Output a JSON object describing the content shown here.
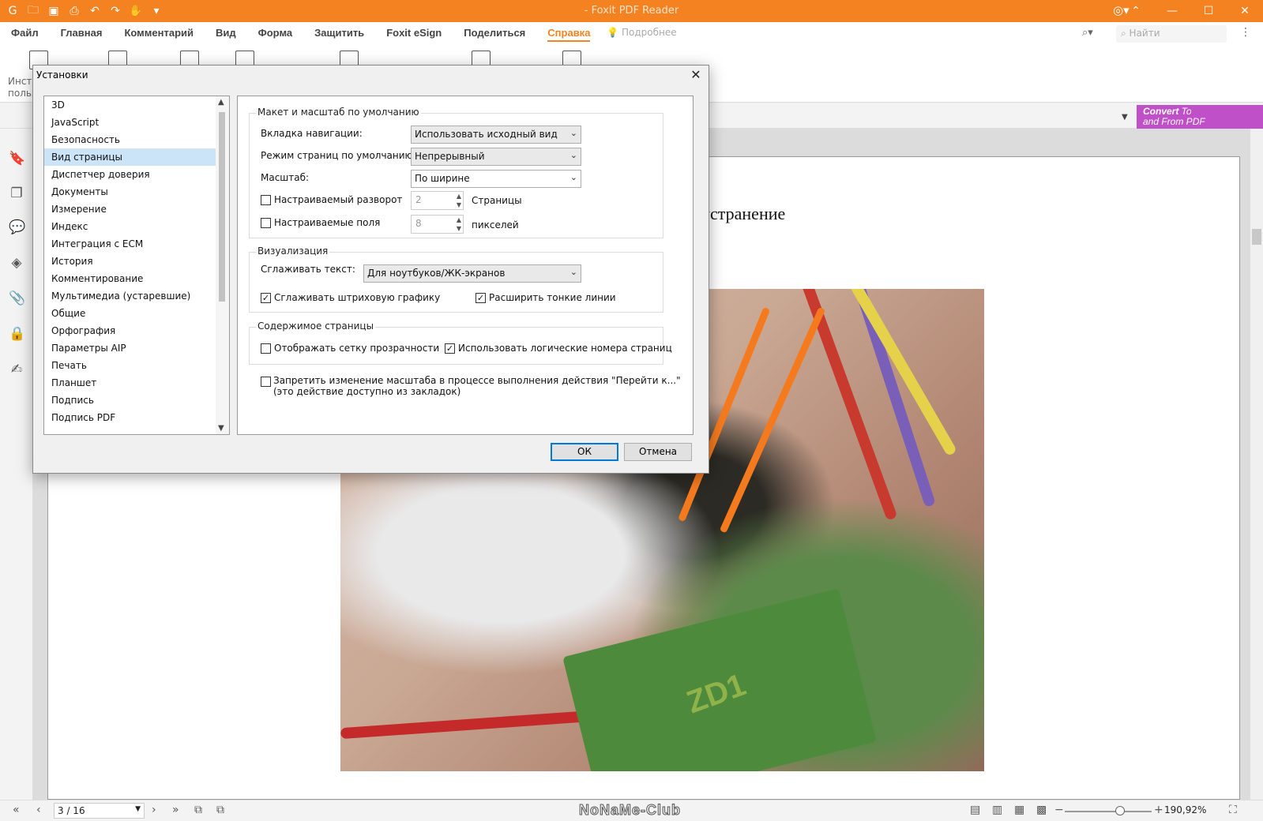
{
  "app": {
    "title": "- Foxit PDF Reader",
    "quick_access": [
      "app-logo",
      "open-icon",
      "save-icon",
      "print-icon",
      "undo-icon",
      "redo-icon",
      "hand-icon",
      "customize-icon"
    ]
  },
  "menu": {
    "items": [
      "Файл",
      "Главная",
      "Комментарий",
      "Вид",
      "Форма",
      "Защитить",
      "Foxit eSign",
      "Поделиться",
      "Справка"
    ],
    "active": "Справка",
    "tip": "Подробнее",
    "search_placeholder": "Найти"
  },
  "ribbon": {
    "partial_label_line1": "Инст",
    "partial_label_line2": "польз"
  },
  "convert_banner": {
    "line1_bold": "Convert",
    "line1_rest": " To",
    "line2": "and From PDF"
  },
  "document": {
    "heading_fragment": "устранение"
  },
  "statusbar": {
    "page_value": "3 / 16",
    "zoom": "190,92%",
    "brand": "NoNaMe-Club"
  },
  "dialog": {
    "title": "Установки",
    "categories": [
      "3D",
      "JavaScript",
      "Безопасность",
      "Вид страницы",
      "Диспетчер доверия",
      "Документы",
      "Измерение",
      "Индекс",
      "Интеграция с ECM",
      "История",
      "Комментирование",
      "Мультимедиа (устаревшие)",
      "Общие",
      "Орфография",
      "Параметры AIP",
      "Печать",
      "Планшет",
      "Подпись",
      "Подпись PDF"
    ],
    "selected_category": "Вид страницы",
    "group_layout": {
      "title": "Макет и масштаб по умолчанию",
      "nav_tab_label": "Вкладка навигации:",
      "nav_tab_value": "Использовать исходный вид",
      "page_mode_label": "Режим страниц по умолчанию:",
      "page_mode_value": "Непрерывный",
      "zoom_label": "Масштаб:",
      "zoom_value": "По ширине",
      "custom_spread_label": "Настраиваемый разворот",
      "custom_spread_value": "2",
      "custom_spread_unit": "Страницы",
      "custom_spread_checked": false,
      "custom_margins_label": "Настраиваемые поля",
      "custom_margins_value": "8",
      "custom_margins_unit": "пикселей",
      "custom_margins_checked": false
    },
    "group_render": {
      "title": "Визуализация",
      "smooth_text_label": "Сглаживать текст:",
      "smooth_text_value": "Для ноутбуков/ЖК-экранов",
      "smooth_lineart_label": "Сглаживать штриховую графику",
      "smooth_lineart_checked": true,
      "enhance_thin_label": "Расширить тонкие линии",
      "enhance_thin_checked": true
    },
    "group_content": {
      "title": "Содержимое страницы",
      "grid_label": "Отображать сетку прозрачности",
      "grid_checked": false,
      "logical_label": "Использовать логические номера страниц",
      "logical_checked": true
    },
    "forbid_zoom_line1": "Запретить изменение масштаба в процессе выполнения действия \"Перейти к...\"",
    "forbid_zoom_line2": "(это действие доступно из закладок)",
    "forbid_zoom_checked": false,
    "ok": "ОК",
    "cancel": "Отмена"
  },
  "colors": {
    "brand_orange": "#f58220",
    "selection_blue": "#cce4f7",
    "convert_purple": "#c050c8"
  }
}
